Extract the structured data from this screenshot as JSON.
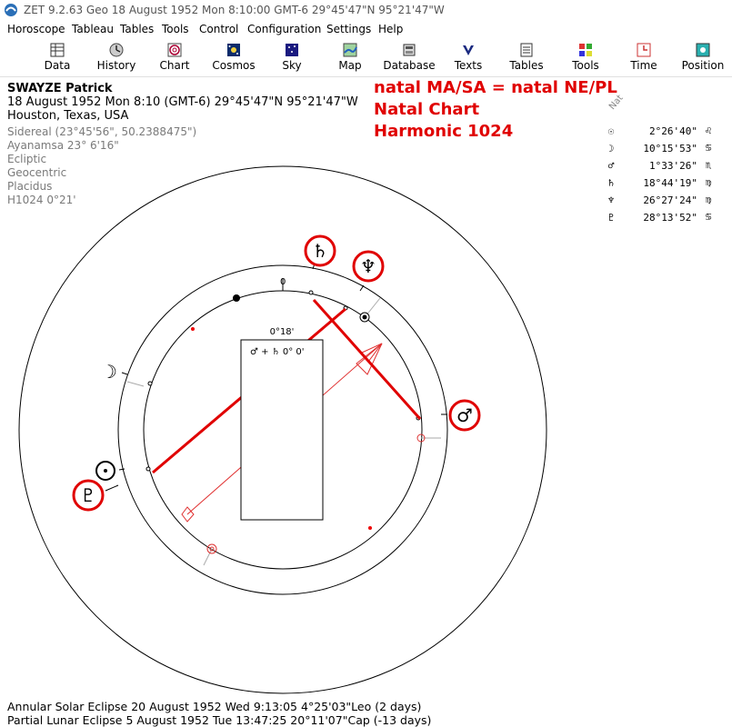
{
  "window": {
    "title": "ZET 9.2.63 Geo   18 August 1952  Mon   8:10:00 GMT-6 29°45'47\"N  95°21'47\"W"
  },
  "menu": [
    "Horoscope",
    "Tableau",
    "Tables",
    "Tools",
    "Control",
    "Configuration",
    "Settings",
    "Help"
  ],
  "toolbar": [
    {
      "label": "Data",
      "icon": "data-icon"
    },
    {
      "label": "History",
      "icon": "history-icon"
    },
    {
      "label": "Chart",
      "icon": "chart-icon"
    },
    {
      "label": "Cosmos",
      "icon": "cosmos-icon"
    },
    {
      "label": "Sky",
      "icon": "sky-icon"
    },
    {
      "label": "Map",
      "icon": "map-icon"
    },
    {
      "label": "Database",
      "icon": "database-icon"
    },
    {
      "label": "Texts",
      "icon": "texts-icon"
    },
    {
      "label": "Tables",
      "icon": "tables-icon"
    },
    {
      "label": "Tools",
      "icon": "tools-icon"
    },
    {
      "label": "Time",
      "icon": "time-icon"
    },
    {
      "label": "Position",
      "icon": "position-icon"
    }
  ],
  "person": {
    "name": "SWAYZE Patrick",
    "datetime": "18 August 1952  Mon   8:10 (GMT-6) 29°45'47\"N  95°21'47\"W",
    "place": "Houston, Texas, USA"
  },
  "settings": [
    "Sidereal (23°45'56\", 50.2388475\")",
    "Ayanamsa 23° 6'16\"",
    "Ecliptic",
    "Geocentric",
    "Placidus",
    "H1024   0°21'"
  ],
  "annotation": {
    "line1": "natal MA/SA = natal NE/PL",
    "line2": "Natal Chart",
    "line3": "Harmonic 1024"
  },
  "table_header": "Nat",
  "planets": [
    {
      "glyph": "☉",
      "value": "2°26'40\"",
      "sign": "♌"
    },
    {
      "glyph": "☽",
      "value": "10°15'53\"",
      "sign": "♋"
    },
    {
      "glyph": "♂",
      "value": "1°33'26\"",
      "sign": "♏"
    },
    {
      "glyph": "♄",
      "value": "18°44'19\"",
      "sign": "♍"
    },
    {
      "glyph": "♆",
      "value": "26°27'24\"",
      "sign": "♍"
    },
    {
      "glyph": "♇",
      "value": "28°13'52\"",
      "sign": "♋"
    }
  ],
  "wheel": {
    "zero_label": "0",
    "box_angle": "0°18'",
    "box_formula": "♂ + ♄   0° 0'",
    "glyphs": {
      "saturn": "♄",
      "neptune": "♆",
      "mars": "♂",
      "moon": "☽",
      "sun": "☉",
      "pluto": "♇"
    }
  },
  "footer": {
    "line1": "Annular Solar Eclipse 20 August 1952 Wed  9:13:05  4°25'03\"Leo (2 days)",
    "line2": "Partial Lunar Eclipse 5 August 1952 Tue 13:47:25 20°11'07\"Cap (-13 days)"
  },
  "colors": {
    "accent": "#e00000",
    "gray_text": "#7a7a7a"
  }
}
